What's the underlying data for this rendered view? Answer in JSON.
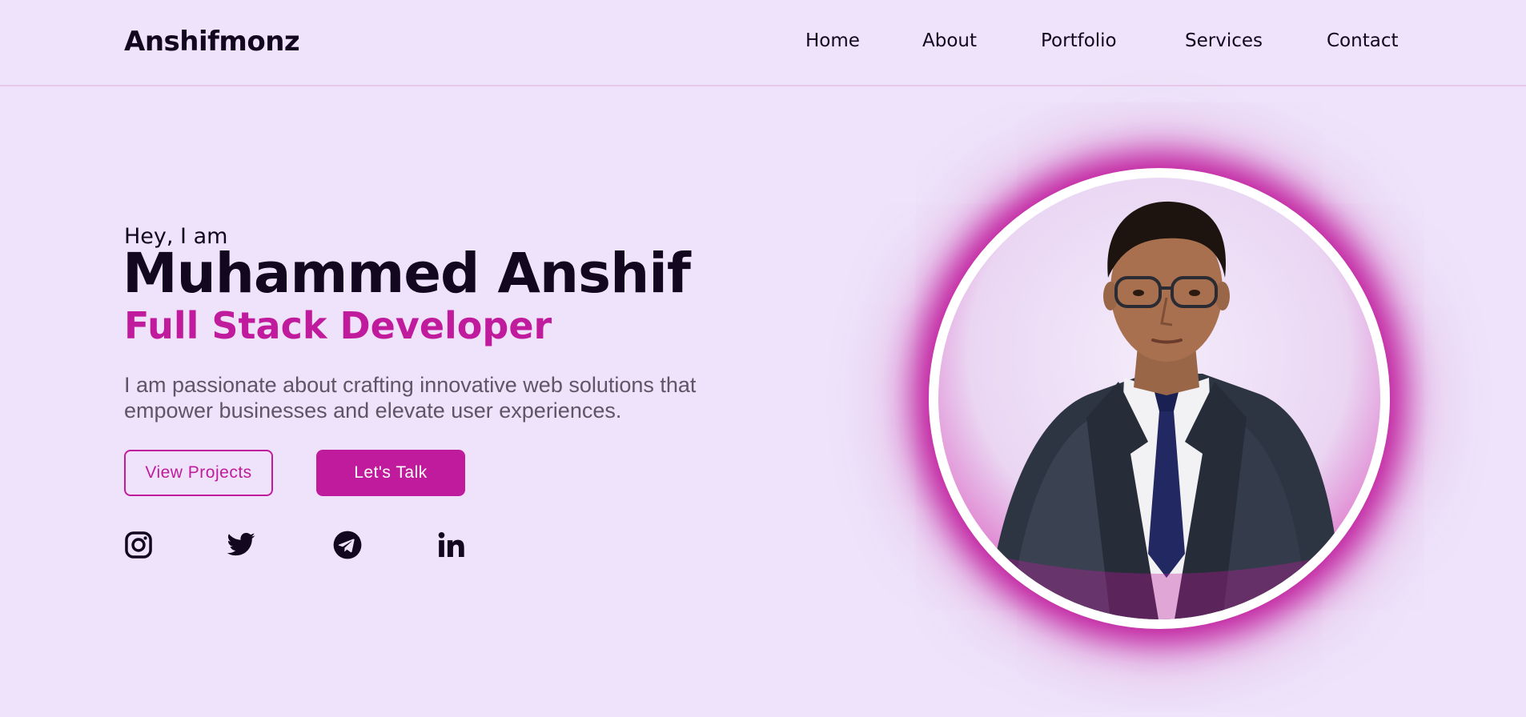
{
  "brand": {
    "logo": "Anshifmonz"
  },
  "nav": {
    "items": [
      {
        "label": "Home",
        "name": "nav-home"
      },
      {
        "label": "About",
        "name": "nav-about"
      },
      {
        "label": "Portfolio",
        "name": "nav-portfolio"
      },
      {
        "label": "Services",
        "name": "nav-services"
      },
      {
        "label": "Contact",
        "name": "nav-contact"
      }
    ]
  },
  "hero": {
    "greeting": "Hey, I am",
    "name": "Muhammed Anshif",
    "role": "Full Stack Developer",
    "description": "I am passionate about crafting innovative web solutions that empower businesses and elevate user experiences.",
    "buttons": {
      "primary_outline": "View Projects",
      "primary_fill": "Let's Talk"
    },
    "social": [
      {
        "icon": "instagram-icon"
      },
      {
        "icon": "twitter-icon"
      },
      {
        "icon": "telegram-icon"
      },
      {
        "icon": "linkedin-icon"
      }
    ]
  },
  "colors": {
    "background": "#eee3fa",
    "accent": "#c01b9d",
    "text": "#13061f",
    "muted": "#5e5566"
  }
}
